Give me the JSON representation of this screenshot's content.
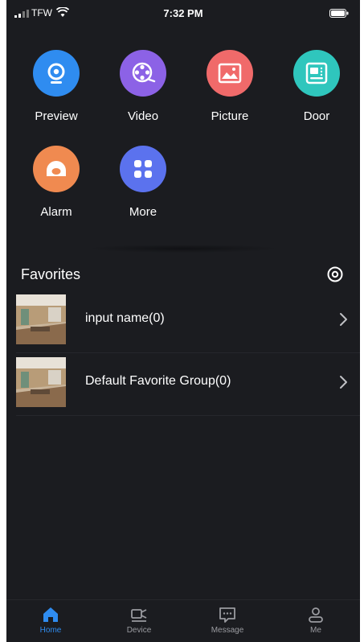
{
  "status_bar": {
    "carrier": "TFW",
    "time": "7:32 PM"
  },
  "apps": [
    {
      "label": "Preview",
      "icon": "camera-icon",
      "color": "#2f8cf0"
    },
    {
      "label": "Video",
      "icon": "film-reel-icon",
      "color": "#8c62e6"
    },
    {
      "label": "Picture",
      "icon": "picture-icon",
      "color": "#f06a6a"
    },
    {
      "label": "Door",
      "icon": "door-intercom-icon",
      "color": "#2fc6bd"
    },
    {
      "label": "Alarm",
      "icon": "alarm-icon",
      "color": "#f08a50"
    },
    {
      "label": "More",
      "icon": "more-grid-icon",
      "color": "#5b72ee"
    }
  ],
  "favorites": {
    "title": "Favorites",
    "items": [
      {
        "name": "input name(0)"
      },
      {
        "name": "Default Favorite Group(0)"
      }
    ]
  },
  "tabs": [
    {
      "label": "Home",
      "icon": "home-icon",
      "active": true
    },
    {
      "label": "Device",
      "icon": "device-icon",
      "active": false
    },
    {
      "label": "Message",
      "icon": "message-icon",
      "active": false
    },
    {
      "label": "Me",
      "icon": "user-icon",
      "active": false
    }
  ],
  "colors": {
    "background": "#1b1c20",
    "accent": "#2f8cf0",
    "inactive_tab": "#9a9ba0"
  }
}
